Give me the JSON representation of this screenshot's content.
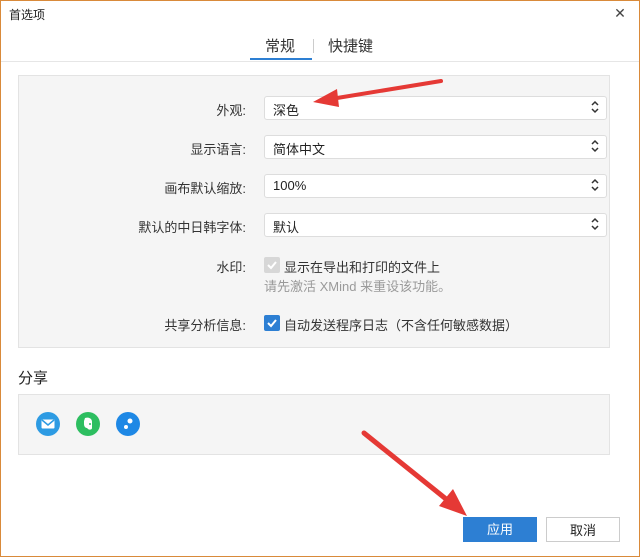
{
  "window": {
    "title": "首选项",
    "close_icon": "close-icon"
  },
  "tabs": [
    {
      "label": "常规",
      "active": true
    },
    {
      "label": "快捷键",
      "active": false
    }
  ],
  "settings": {
    "appearance": {
      "label": "外观:",
      "value": "深色"
    },
    "display_language": {
      "label": "显示语言:",
      "value": "简体中文"
    },
    "canvas_zoom": {
      "label": "画布默认缩放:",
      "value": "100%"
    },
    "cjk_font": {
      "label": "默认的中日韩字体:",
      "value": "默认"
    },
    "watermark": {
      "label": "水印:",
      "checkbox_text": "显示在导出和打印的文件上",
      "checked": true,
      "disabled": true,
      "hint": "请先激活 XMind 来重设该功能。"
    },
    "analytics": {
      "label": "共享分析信息:",
      "checkbox_text": "自动发送程序日志（不含任何敏感数据）",
      "checked": true
    }
  },
  "share": {
    "title": "分享",
    "icons": [
      "email-icon",
      "evernote-icon",
      "share-app-icon"
    ]
  },
  "footer": {
    "apply_label": "应用",
    "cancel_label": "取消"
  },
  "colors": {
    "accent": "#2d7fd3",
    "arrow": "#e53935",
    "evernote": "#2dbe60"
  }
}
